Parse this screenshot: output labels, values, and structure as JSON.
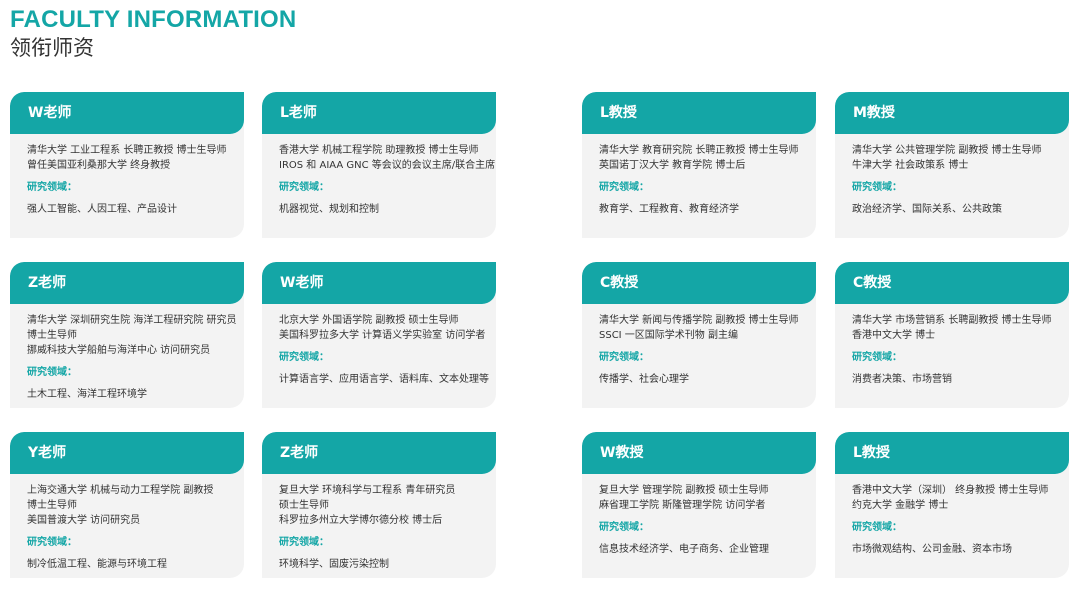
{
  "header": {
    "title_en": "FACULTY INFORMATION",
    "title_cn": "领衔师资"
  },
  "field_label": "研究领域：",
  "faculty": [
    {
      "name": "W老师",
      "bio": [
        "清华大学 工业工程系 长聘正教授 博士生导师",
        "曾任美国亚利桑那大学 终身教授"
      ],
      "fields": "强人工智能、人因工程、产品设计"
    },
    {
      "name": "L老师",
      "bio": [
        "香港大学 机械工程学院 助理教授 博士生导师",
        "IROS 和 AIAA GNC 等会议的会议主席/联合主席"
      ],
      "fields": "机器视觉、规划和控制"
    },
    {
      "name": "L教授",
      "bio": [
        "清华大学 教育研究院 长聘正教授 博士生导师",
        "英国诺丁汉大学 教育学院 博士后"
      ],
      "fields": "教育学、工程教育、教育经济学"
    },
    {
      "name": "M教授",
      "bio": [
        "清华大学 公共管理学院 副教授 博士生导师",
        "牛津大学 社会政策系 博士"
      ],
      "fields": "政治经济学、国际关系、公共政策"
    },
    {
      "name": "Z老师",
      "bio": [
        "清华大学 深圳研究生院 海洋工程研究院 研究员",
        "博士生导师",
        "挪威科技大学船舶与海洋中心 访问研究员"
      ],
      "fields": "土木工程、海洋工程环境学"
    },
    {
      "name": "W老师",
      "bio": [
        "北京大学 外国语学院 副教授 硕士生导师",
        "美国科罗拉多大学 计算语义学实验室 访问学者"
      ],
      "fields": "计算语言学、应用语言学、语料库、文本处理等"
    },
    {
      "name": "C教授",
      "bio": [
        "清华大学 新闻与传播学院 副教授 博士生导师",
        "SSCI 一区国际学术刊物 副主编"
      ],
      "fields": "传播学、社会心理学"
    },
    {
      "name": "C教授",
      "bio": [
        "清华大学 市场营销系 长聘副教授 博士生导师",
        "香港中文大学 博士"
      ],
      "fields": "消费者决策、市场营销"
    },
    {
      "name": "Y老师",
      "bio": [
        "上海交通大学 机械与动力工程学院 副教授",
        "博士生导师",
        "美国普渡大学 访问研究员"
      ],
      "fields": "制冷低温工程、能源与环境工程"
    },
    {
      "name": "Z老师",
      "bio": [
        "复旦大学 环境科学与工程系 青年研究员",
        "硕士生导师",
        "科罗拉多州立大学博尔德分校 博士后"
      ],
      "fields": "环境科学、固废污染控制"
    },
    {
      "name": "W教授",
      "bio": [
        "复旦大学 管理学院 副教授 硕士生导师",
        "麻省理工学院 斯隆管理学院 访问学者"
      ],
      "fields": "信息技术经济学、电子商务、企业管理"
    },
    {
      "name": "L教授",
      "bio": [
        "香港中文大学（深圳） 终身教授 博士生导师",
        "约克大学 金融学 博士"
      ],
      "fields": "市场微观结构、公司金融、资本市场"
    }
  ]
}
